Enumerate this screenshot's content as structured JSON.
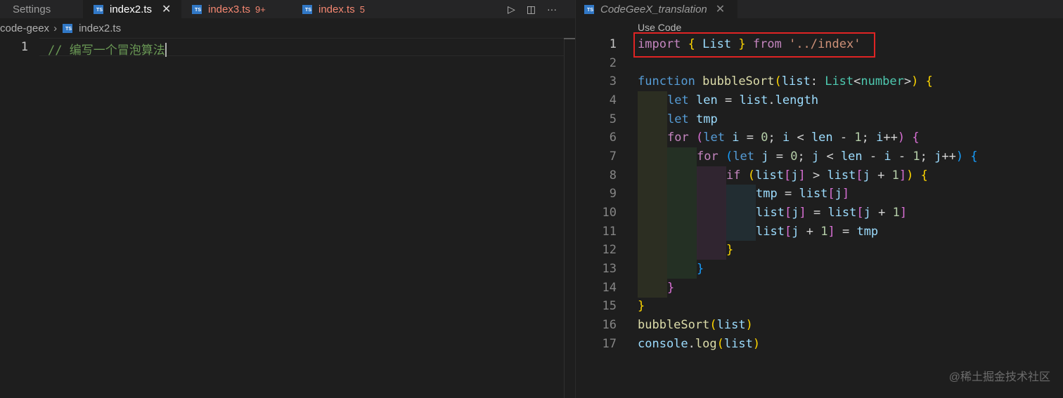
{
  "left_editor": {
    "tabs": [
      {
        "label": "Settings",
        "badge": "",
        "state": "inactive"
      },
      {
        "label": "index2.ts",
        "badge": "",
        "state": "active"
      },
      {
        "label": "index3.ts",
        "badge": "9+",
        "state": "modified"
      },
      {
        "label": "index.ts",
        "badge": "5",
        "state": "modified"
      }
    ],
    "close_glyph": "✕",
    "actions": {
      "run": "▷",
      "split": "◫",
      "more": "···"
    },
    "breadcrumbs": [
      "code-geex",
      "index2.ts"
    ],
    "breadcrumb_separator": "›",
    "lines": [
      {
        "number": "1",
        "text": "// 编写一个冒泡算法"
      }
    ]
  },
  "right_editor": {
    "tab": {
      "label": "CodeGeeX_translation",
      "close_glyph": "✕"
    },
    "use_code_label": "Use Code",
    "line_numbers": [
      "1",
      "2",
      "3",
      "4",
      "5",
      "6",
      "7",
      "8",
      "9",
      "10",
      "11",
      "12",
      "13",
      "14",
      "15",
      "16",
      "17"
    ],
    "code": {
      "l1": {
        "import": "import",
        "brace_open": "{",
        "List": "List",
        "brace_close": "}",
        "from": "from",
        "path": "'../index'"
      },
      "l3": {
        "function": "function",
        "name": "bubbleSort",
        "paren_open": "(",
        "param": "list",
        "colon": ":",
        "type": "List",
        "generic_open": "<",
        "generic_type": "number",
        "generic_close": ">",
        "paren_close": ")",
        "brace": "{"
      },
      "l4": {
        "let": "let",
        "var": "len",
        "eq": "=",
        "obj": "list",
        "dot": ".",
        "prop": "length"
      },
      "l5": {
        "let": "let",
        "var": "tmp"
      },
      "l6": {
        "for": "for",
        "paren_open": "(",
        "let": "let",
        "init_var": "i",
        "eq": "=",
        "zero": "0",
        "semi1": ";",
        "cond_var": "i",
        "lt": "<",
        "len": "len",
        "minus": "-",
        "one": "1",
        "semi2": ";",
        "inc_var": "i",
        "inc": "++",
        "paren_close": ")",
        "brace": "{"
      },
      "l7": {
        "for": "for",
        "paren_open": "(",
        "let": "let",
        "init_var": "j",
        "eq": "=",
        "zero": "0",
        "semi1": ";",
        "cond_var": "j",
        "lt": "<",
        "len": "len",
        "minus1": "-",
        "i": "i",
        "minus2": "-",
        "one": "1",
        "semi2": ";",
        "inc_var": "j",
        "inc": "++",
        "paren_close": ")",
        "brace": "{"
      },
      "l8": {
        "if": "if",
        "paren_open": "(",
        "list1": "list",
        "b_open1": "[",
        "j1": "j",
        "b_close1": "]",
        "gt": ">",
        "list2": "list",
        "b_open2": "[",
        "j2": "j",
        "plus": "+",
        "one": "1",
        "b_close2": "]",
        "paren_close": ")",
        "brace": "{"
      },
      "l9": {
        "tmp": "tmp",
        "eq": "=",
        "list": "list",
        "b_open": "[",
        "j": "j",
        "b_close": "]"
      },
      "l10": {
        "list1": "list",
        "b_open1": "[",
        "j1": "j",
        "b_close1": "]",
        "eq": "=",
        "list2": "list",
        "b_open2": "[",
        "j2": "j",
        "plus": "+",
        "one": "1",
        "b_close2": "]"
      },
      "l11": {
        "list": "list",
        "b_open": "[",
        "j": "j",
        "plus": "+",
        "one": "1",
        "b_close": "]",
        "eq": "=",
        "tmp": "tmp"
      },
      "l12": {
        "brace": "}"
      },
      "l13": {
        "brace": "}"
      },
      "l14": {
        "brace": "}"
      },
      "l15": {
        "brace": "}"
      },
      "l16": {
        "name": "bubbleSort",
        "paren_open": "(",
        "arg": "list",
        "paren_close": ")"
      },
      "l17": {
        "obj": "console",
        "dot": ".",
        "method": "log",
        "paren_open": "(",
        "arg": "list",
        "paren_close": ")"
      }
    }
  },
  "watermark": "@稀土掘金技术社区",
  "colors": {
    "highlight_box": "#e02424",
    "ts_icon": "#3178c6",
    "modified_tab": "#f48771",
    "editor_bg": "#1e1e1e"
  }
}
